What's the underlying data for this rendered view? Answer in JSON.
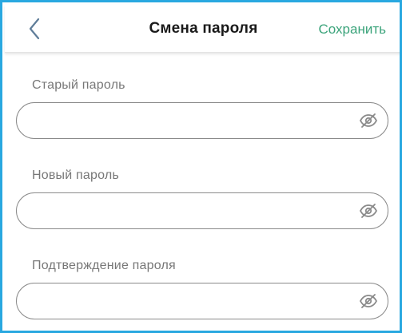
{
  "header": {
    "back_icon": "chevron-left-icon",
    "title": "Смена пароля",
    "save_label": "Сохранить"
  },
  "fields": [
    {
      "label": "Старый пароль",
      "value": "",
      "placeholder": "",
      "toggle_icon": "eye-off-icon"
    },
    {
      "label": "Новый пароль",
      "value": "",
      "placeholder": "",
      "toggle_icon": "eye-off-icon"
    },
    {
      "label": "Подтверждение пароля",
      "value": "",
      "placeholder": "",
      "toggle_icon": "eye-off-icon"
    }
  ],
  "colors": {
    "accent_save": "#3aa37a",
    "back_icon": "#5f7d99",
    "frame_border": "#29a8e0",
    "field_border": "#8a8a8a",
    "label": "#777777"
  }
}
